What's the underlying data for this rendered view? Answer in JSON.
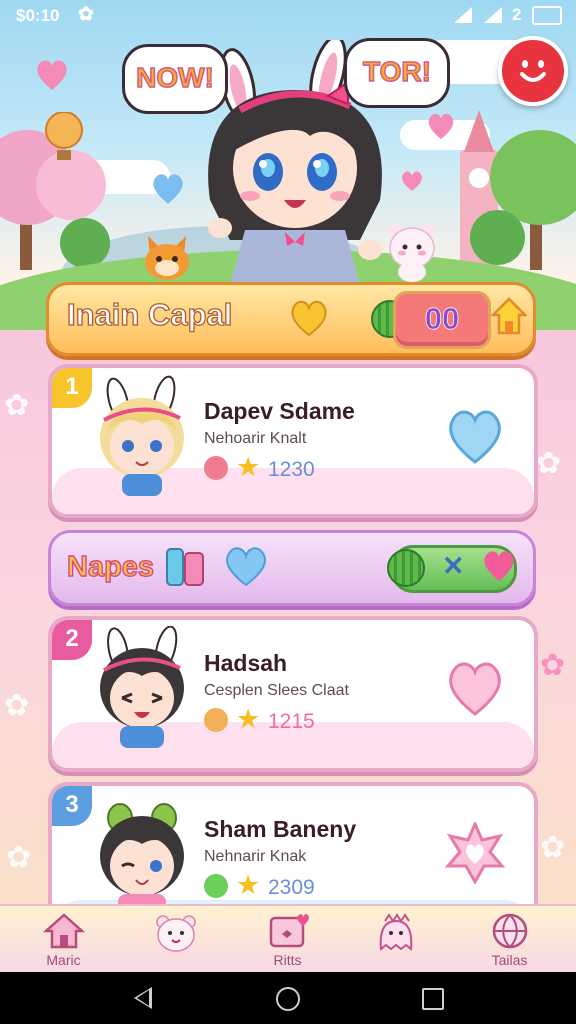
{
  "status_bar": {
    "time": "$0:10",
    "gear_glyph": "✿",
    "battery_number": "2"
  },
  "hero": {
    "bubble_left": "NOW!",
    "bubble_right": "TOR!",
    "action_icon": "smile-face-icon"
  },
  "banner": {
    "title": "Inain Capal",
    "counter": "00"
  },
  "cards": [
    {
      "rank": "1",
      "name": "Dapev Sdame",
      "subtitle": "Nehoarir Knalt",
      "score": "1230",
      "rank_color": "#f7c52b",
      "coin_color": "#ef7c8e"
    },
    {
      "rank": "2",
      "name": "Hadsah",
      "subtitle": "Cesplen Slees Claat",
      "score": "1215",
      "rank_color": "#e85b9e",
      "coin_color": "#f3b05a"
    },
    {
      "rank": "3",
      "name": "Sham Baneny",
      "subtitle": "Nehnarir Knak",
      "score": "2309",
      "rank_color": "#5c9fe0",
      "coin_color": "#6ccf5a"
    }
  ],
  "napes": {
    "label": "Napes",
    "pill_glyph": "✕"
  },
  "nav": [
    {
      "label": "Maric",
      "icon": "house-icon"
    },
    {
      "label": "",
      "icon": "bear-icon"
    },
    {
      "label": "Ritts",
      "icon": "picture-heart-icon"
    },
    {
      "label": "",
      "icon": "ghost-crown-icon"
    },
    {
      "label": "Tailas",
      "icon": "globe-icon"
    }
  ]
}
